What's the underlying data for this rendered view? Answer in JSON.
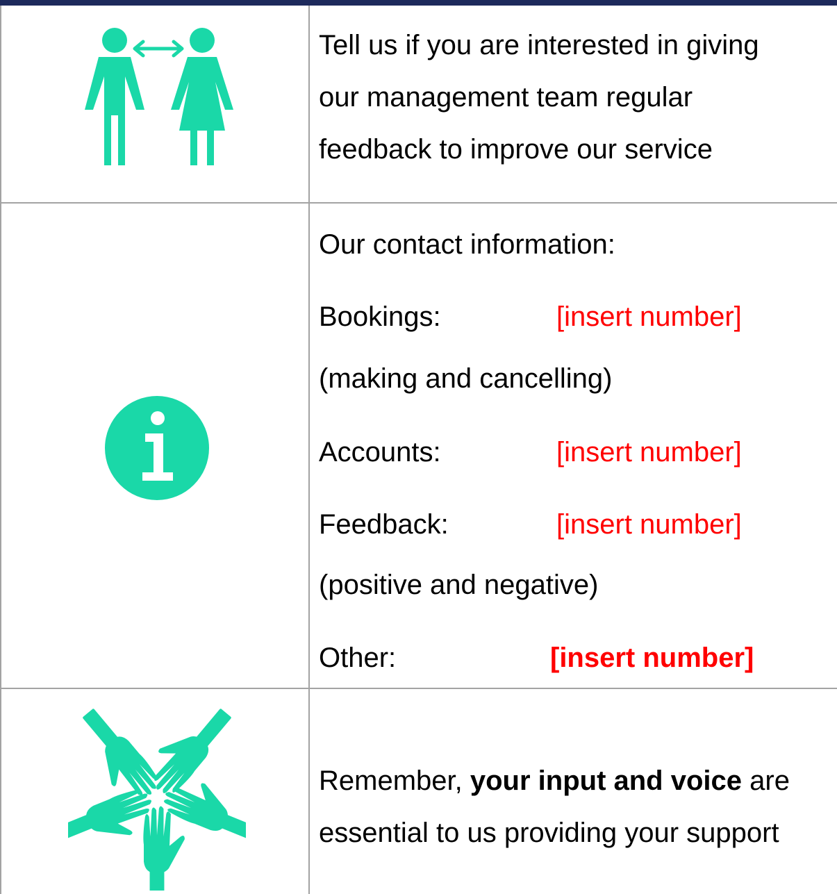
{
  "section1": {
    "lines": [
      "Tell us if you are interested in giving",
      "our management team regular",
      "feedback to improve our service"
    ]
  },
  "section2": {
    "heading": "Our contact information:",
    "contacts": [
      {
        "label": "Bookings:",
        "value": "[insert number]",
        "note": "(making and cancelling)"
      },
      {
        "label": "Accounts:",
        "value": "[insert number]"
      },
      {
        "label": "Feedback:",
        "value": "[insert number]",
        "note": "(positive and negative)"
      },
      {
        "label": "Other:",
        "value": "[insert number]"
      }
    ]
  },
  "section3": {
    "prefix": "Remember, ",
    "emphasis": "your input and voice",
    "suffix": " are",
    "line2": "essential to us providing your support"
  },
  "colors": {
    "icon": "#1ad8a8",
    "placeholder": "#ff0000",
    "top_bar": "#1d2a5c",
    "border": "#a3a3a3"
  },
  "icons": [
    "two-people-exchange-icon",
    "info-icon",
    "hands-circle-icon"
  ]
}
